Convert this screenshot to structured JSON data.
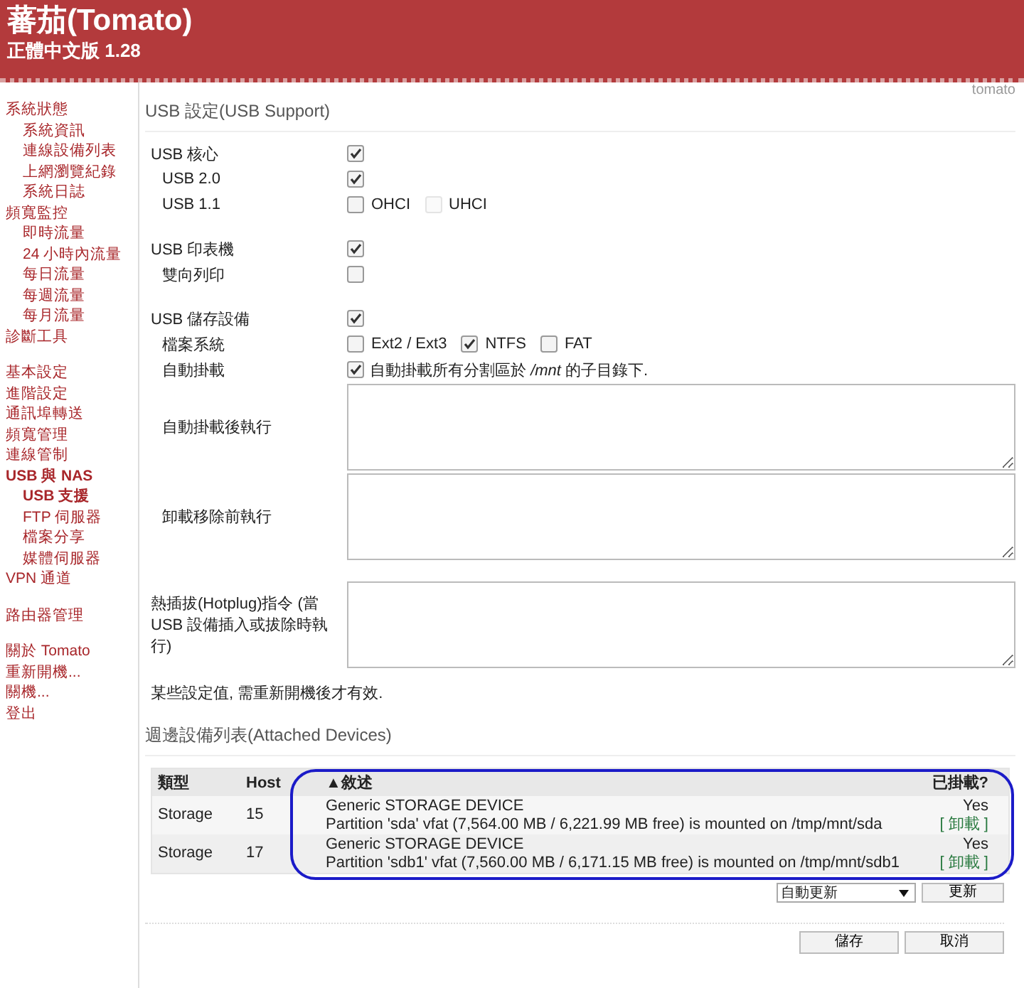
{
  "header": {
    "title": "蕃茄(Tomato)",
    "subtitle": "正體中文版 1.28"
  },
  "sidebar": {
    "groups": [
      [
        {
          "label": "系統狀態",
          "selected": false,
          "children": [
            {
              "label": "系統資訊",
              "selected": false
            },
            {
              "label": "連線設備列表",
              "selected": false
            },
            {
              "label": "上網瀏覽紀錄",
              "selected": false
            },
            {
              "label": "系統日誌",
              "selected": false
            }
          ]
        },
        {
          "label": "頻寬監控",
          "selected": false,
          "children": [
            {
              "label": "即時流量",
              "selected": false
            },
            {
              "label": "24 小時內流量",
              "selected": false
            },
            {
              "label": "每日流量",
              "selected": false
            },
            {
              "label": "每週流量",
              "selected": false
            },
            {
              "label": "每月流量",
              "selected": false
            }
          ]
        },
        {
          "label": "診斷工具",
          "selected": false
        }
      ],
      [
        {
          "label": "基本設定",
          "selected": false
        },
        {
          "label": "進階設定",
          "selected": false
        },
        {
          "label": "通訊埠轉送",
          "selected": false
        },
        {
          "label": "頻寬管理",
          "selected": false
        },
        {
          "label": "連線管制",
          "selected": false
        },
        {
          "label": "USB 與 NAS",
          "selected": true,
          "children": [
            {
              "label": "USB 支援",
              "selected": true
            },
            {
              "label": "FTP 伺服器",
              "selected": false
            },
            {
              "label": "檔案分享",
              "selected": false
            },
            {
              "label": "媒體伺服器",
              "selected": false
            }
          ]
        },
        {
          "label": "VPN 通道",
          "selected": false
        }
      ],
      [
        {
          "label": "路由器管理",
          "selected": false
        }
      ],
      [
        {
          "label": "關於 Tomato",
          "selected": false
        },
        {
          "label": "重新開機...",
          "selected": false
        },
        {
          "label": "關機...",
          "selected": false
        },
        {
          "label": "登出",
          "selected": false
        }
      ]
    ]
  },
  "router_name": "tomato",
  "settings": {
    "title": "USB 設定(USB Support)",
    "sections": [
      [
        {
          "kind": "checkbox",
          "label": "USB 核心",
          "checked": true,
          "children": [
            {
              "kind": "checkbox",
              "label": "USB 2.0",
              "checked": true
            },
            {
              "kind": "options",
              "label": "USB 1.1",
              "options": [
                {
                  "label": "OHCI",
                  "checked": false,
                  "disabled": false
                },
                {
                  "label": "UHCI",
                  "checked": false,
                  "disabled": true
                }
              ]
            }
          ]
        }
      ],
      [
        {
          "kind": "checkbox",
          "label": "USB 印表機",
          "checked": true,
          "children": [
            {
              "kind": "checkbox",
              "label": "雙向列印",
              "checked": false
            }
          ]
        }
      ],
      [
        {
          "kind": "checkbox",
          "label": "USB 儲存設備",
          "checked": true,
          "children": [
            {
              "kind": "options",
              "label": "檔案系統",
              "options": [
                {
                  "label": "Ext2 / Ext3",
                  "checked": false,
                  "disabled": false
                },
                {
                  "label": "NTFS",
                  "checked": true,
                  "disabled": false
                },
                {
                  "label": "FAT",
                  "checked": false,
                  "disabled": false
                }
              ]
            },
            {
              "kind": "checkbox",
              "label": "自動掛載",
              "checked": true,
              "text": "自動掛載所有分割區於 */mnt* 的子目錄下."
            },
            {
              "kind": "textarea",
              "label": "自動掛載後執行"
            },
            {
              "kind": "textarea",
              "label": "卸載移除前執行"
            }
          ]
        }
      ],
      [
        {
          "kind": "textarea",
          "label": "熱插拔(Hotplug)指令 (當 USB 設備插入或拔除時執行)"
        }
      ]
    ],
    "note": "某些設定值, 需重新開機後才有效."
  },
  "devices": {
    "title": "週邊設備列表(Attached Devices)",
    "columns": [
      {
        "label": "類型"
      },
      {
        "label": "Host"
      },
      {
        "label": "敘述",
        "sort_arrow": "▲"
      },
      {
        "label": "已掛載?"
      }
    ],
    "rows": [
      {
        "type": "Storage",
        "host": "15",
        "description": [
          "Generic STORAGE DEVICE",
          "Partition 'sda' vfat (7,564.00 MB / 6,221.99 MB free) is mounted on /tmp/mnt/sda"
        ],
        "mounted": "Yes",
        "action": "[ 卸載 ]"
      },
      {
        "type": "Storage",
        "host": "17",
        "description": [
          "Generic STORAGE DEVICE",
          "Partition 'sdb1' vfat (7,560.00 MB / 6,171.15 MB free) is mounted on /tmp/mnt/sdb1"
        ],
        "mounted": "Yes",
        "action": "[ 卸載 ]"
      }
    ],
    "callout": {
      "kind": "rounded-outline"
    },
    "refresh_select": "自動更新",
    "refresh_button": "更新"
  },
  "buttons": [
    "儲存",
    "取消"
  ]
}
